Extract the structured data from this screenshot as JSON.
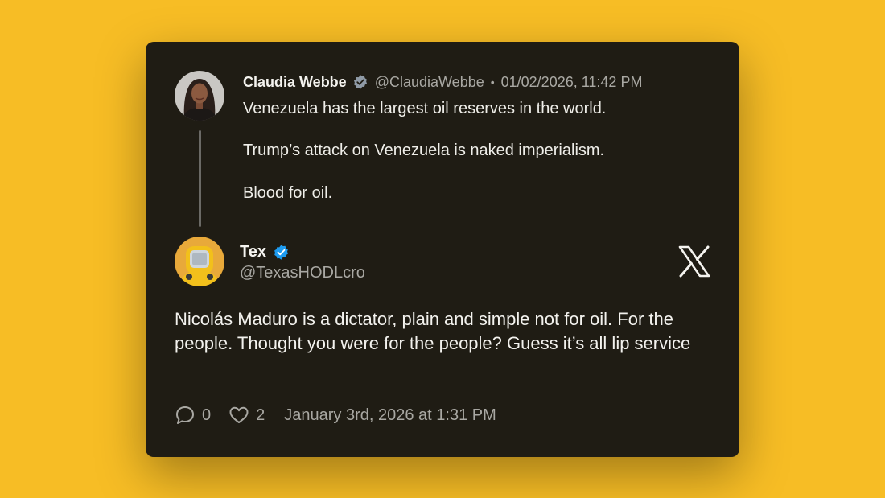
{
  "quoted_tweet": {
    "author_name": "Claudia Webbe",
    "handle": "@ClaudiaWebbe",
    "separator": "•",
    "datetime": "01/02/2026, 11:42 PM",
    "lines": [
      "Venezuela has the largest oil reserves in the world.",
      "Trump’s attack on Venezuela is naked imperialism.",
      "Blood for oil."
    ],
    "badge_color": "#8f9aa6"
  },
  "reply_tweet": {
    "author_name": "Tex",
    "handle": "@TexasHODLcro",
    "text": "Nicolás Maduro is a dictator, plain and simple not for oil. For the people. Thought you were for the people? Guess it’s all lip service",
    "badge_color": "#1d9bf0",
    "reply_count": "0",
    "like_count": "2",
    "timestamp": "January 3rd, 2026 at 1:31 PM"
  },
  "icons": {
    "platform_logo": "x-logo-icon",
    "reply": "speech-bubble-icon",
    "like": "heart-icon",
    "verified": "verified-badge-icon"
  },
  "colors": {
    "background": "#f7bd25",
    "card": "#1f1c14",
    "text_primary": "#f1f0ec",
    "text_secondary": "#a9a8a3"
  }
}
